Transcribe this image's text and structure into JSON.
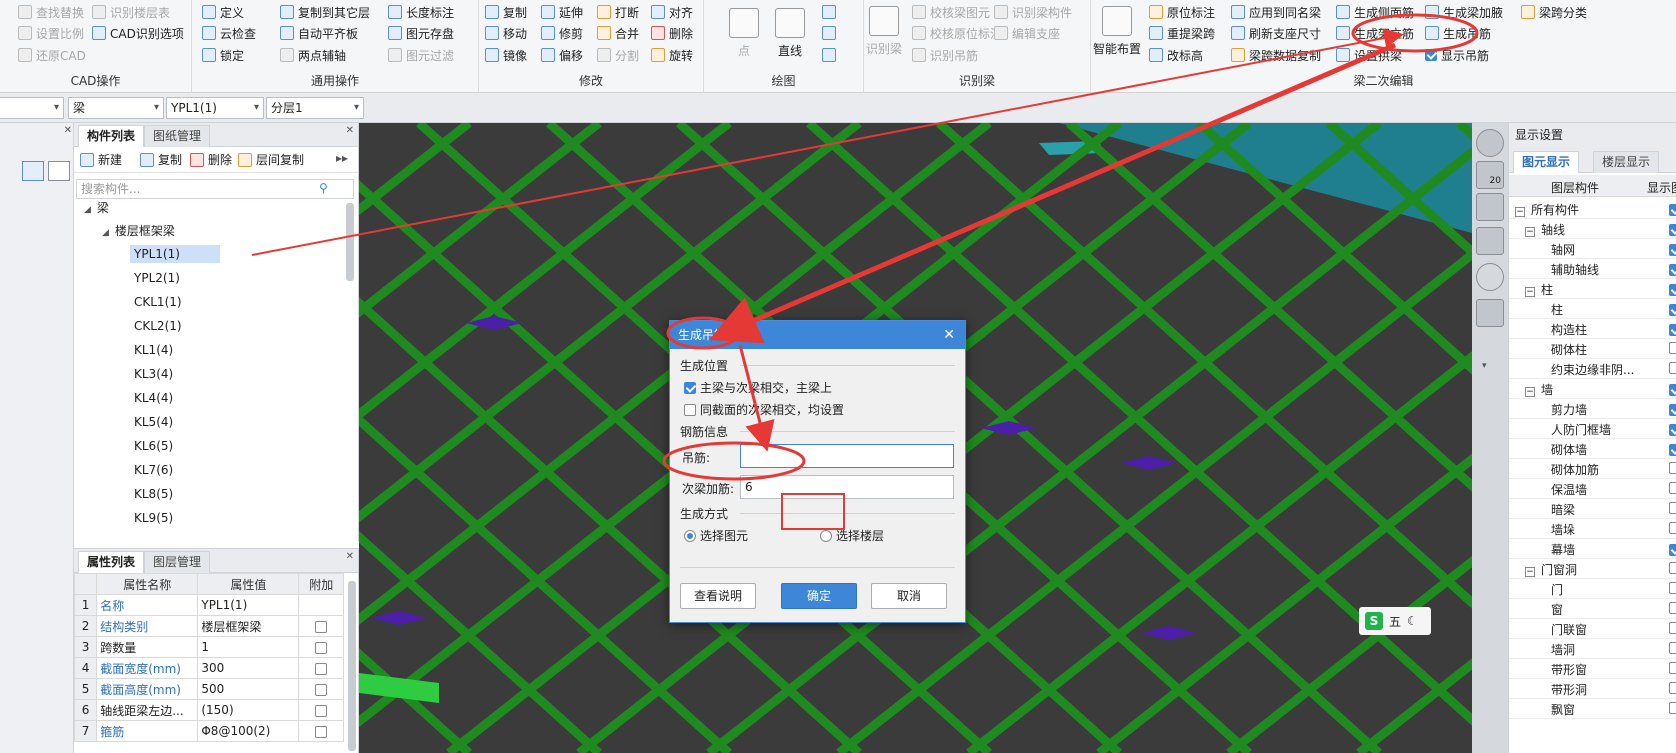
{
  "ribbon": {
    "cad_group": {
      "title": "CAD操作",
      "items": [
        "查找替换",
        "识别楼层表",
        "设置比例",
        "CAD识别选项",
        "还原CAD"
      ]
    },
    "common_group": {
      "title": "通用操作",
      "items": [
        "定义",
        "复制到其它层",
        "长度标注",
        "云检查",
        "自动平齐板",
        "图元存盘",
        "锁定",
        "两点辅轴",
        "图元过滤"
      ]
    },
    "modify_group": {
      "title": "修改",
      "items": [
        "复制",
        "延伸",
        "打断",
        "对齐",
        "移动",
        "修剪",
        "合并",
        "删除",
        "镜像",
        "偏移",
        "分割",
        "旋转"
      ]
    },
    "draw_group": {
      "title": "绘图",
      "items": [
        "点",
        "直线"
      ]
    },
    "recognize_group": {
      "title": "识别梁",
      "items": [
        "识别梁",
        "校核梁图元",
        "识别梁构件",
        "校核原位标注",
        "编辑支座",
        "识别吊筋"
      ]
    },
    "beam_edit_group": {
      "title": "梁二次编辑",
      "items": [
        "智能布置",
        "原位标注",
        "应用到同名梁",
        "生成侧面筋",
        "生成梁加腋",
        "梁跨分类",
        "重提梁跨",
        "刷新支座尺寸",
        "生成架立筋",
        "生成吊筋",
        "改标高",
        "梁跨数据复制",
        "设置拱梁",
        "显示吊筋"
      ]
    }
  },
  "selector_bar": {
    "layer_type": "梁",
    "component": "YPL1(1)",
    "floor": "分层1"
  },
  "component_panel": {
    "tabs": [
      "构件列表",
      "图纸管理"
    ],
    "toolbar": [
      "新建",
      "复制",
      "删除",
      "层间复制"
    ],
    "search_placeholder": "搜索构件...",
    "tree_root": "梁",
    "tree_group": "楼层框架梁",
    "items": [
      "YPL1(1)",
      "YPL2(1)",
      "CKL1(1)",
      "CKL2(1)",
      "KL1(4)",
      "KL3(4)",
      "KL4(4)",
      "KL5(4)",
      "KL6(5)",
      "KL7(6)",
      "KL8(5)",
      "KL9(5)"
    ]
  },
  "property_panel": {
    "tabs": [
      "属性列表",
      "图层管理"
    ],
    "headers": [
      "属性名称",
      "属性值",
      "附加"
    ],
    "rows": [
      {
        "no": "1",
        "name": "名称",
        "value": "YPL1(1)",
        "blue": true,
        "check": false
      },
      {
        "no": "2",
        "name": "结构类别",
        "value": "楼层框架梁",
        "blue": true,
        "check": true
      },
      {
        "no": "3",
        "name": "跨数量",
        "value": "1",
        "blue": false,
        "check": true
      },
      {
        "no": "4",
        "name": "截面宽度(mm)",
        "value": "300",
        "blue": true,
        "check": true
      },
      {
        "no": "5",
        "name": "截面高度(mm)",
        "value": "500",
        "blue": true,
        "check": true
      },
      {
        "no": "6",
        "name": "轴线距梁左边...",
        "value": "(150)",
        "blue": false,
        "check": true
      },
      {
        "no": "7",
        "name": "箍筋",
        "value": "Φ8@100(2)",
        "blue": true,
        "check": true
      }
    ]
  },
  "display_settings": {
    "title": "显示设置",
    "tabs": [
      "图元显示",
      "楼层显示"
    ],
    "headers": [
      "图层构件",
      "显示图"
    ],
    "rows": [
      {
        "label": "所有构件",
        "level": 0,
        "group": true,
        "checked": true
      },
      {
        "label": "轴线",
        "level": 1,
        "group": true,
        "checked": true
      },
      {
        "label": "轴网",
        "level": 2,
        "group": false,
        "checked": true
      },
      {
        "label": "辅助轴线",
        "level": 2,
        "group": false,
        "checked": true
      },
      {
        "label": "柱",
        "level": 1,
        "group": true,
        "checked": true
      },
      {
        "label": "柱",
        "level": 2,
        "group": false,
        "checked": true
      },
      {
        "label": "构造柱",
        "level": 2,
        "group": false,
        "checked": true
      },
      {
        "label": "砌体柱",
        "level": 2,
        "group": false,
        "checked": false
      },
      {
        "label": "约束边缘非阴...",
        "level": 2,
        "group": false,
        "checked": false
      },
      {
        "label": "墙",
        "level": 1,
        "group": true,
        "checked": true
      },
      {
        "label": "剪力墙",
        "level": 2,
        "group": false,
        "checked": true
      },
      {
        "label": "人防门框墙",
        "level": 2,
        "group": false,
        "checked": true
      },
      {
        "label": "砌体墙",
        "level": 2,
        "group": false,
        "checked": true
      },
      {
        "label": "砌体加筋",
        "level": 2,
        "group": false,
        "checked": false
      },
      {
        "label": "保温墙",
        "level": 2,
        "group": false,
        "checked": false
      },
      {
        "label": "暗梁",
        "level": 2,
        "group": false,
        "checked": false
      },
      {
        "label": "墙垛",
        "level": 2,
        "group": false,
        "checked": false
      },
      {
        "label": "幕墙",
        "level": 2,
        "group": false,
        "checked": true
      },
      {
        "label": "门窗洞",
        "level": 1,
        "group": true,
        "checked": false
      },
      {
        "label": "门",
        "level": 2,
        "group": false,
        "checked": false
      },
      {
        "label": "窗",
        "level": 2,
        "group": false,
        "checked": false
      },
      {
        "label": "门联窗",
        "level": 2,
        "group": false,
        "checked": false
      },
      {
        "label": "墙洞",
        "level": 2,
        "group": false,
        "checked": false
      },
      {
        "label": "带形窗",
        "level": 2,
        "group": false,
        "checked": false
      },
      {
        "label": "带形洞",
        "level": 2,
        "group": false,
        "checked": false
      },
      {
        "label": "飘窗",
        "level": 2,
        "group": false,
        "checked": false
      }
    ]
  },
  "view_tools": {
    "zoom_badge": "20"
  },
  "ime_badge": {
    "label": "五"
  },
  "dialog": {
    "title": "生成吊筋",
    "section_position": "生成位置",
    "opt_main_beam": "主梁与次梁相交，主梁上",
    "opt_main_beam_checked": true,
    "opt_same_section": "同截面的次梁相交，均设置",
    "opt_same_section_checked": false,
    "section_rebar": "钢筋信息",
    "hanger_label": "吊筋:",
    "hanger_value": "",
    "secondary_label": "次梁加筋:",
    "secondary_value": "6",
    "section_method": "生成方式",
    "radio_select_element": "选择图元",
    "radio_select_floor": "选择楼层",
    "selected_method": "选择图元",
    "btn_help": "查看说明",
    "btn_ok": "确定",
    "btn_cancel": "取消"
  },
  "colors": {
    "accent": "#3e87d8",
    "annotation_red": "#e53935",
    "beam_green": "#1f8a1f",
    "slab_dark": "#3b3b3b",
    "node_purple": "#4b1fa8"
  }
}
